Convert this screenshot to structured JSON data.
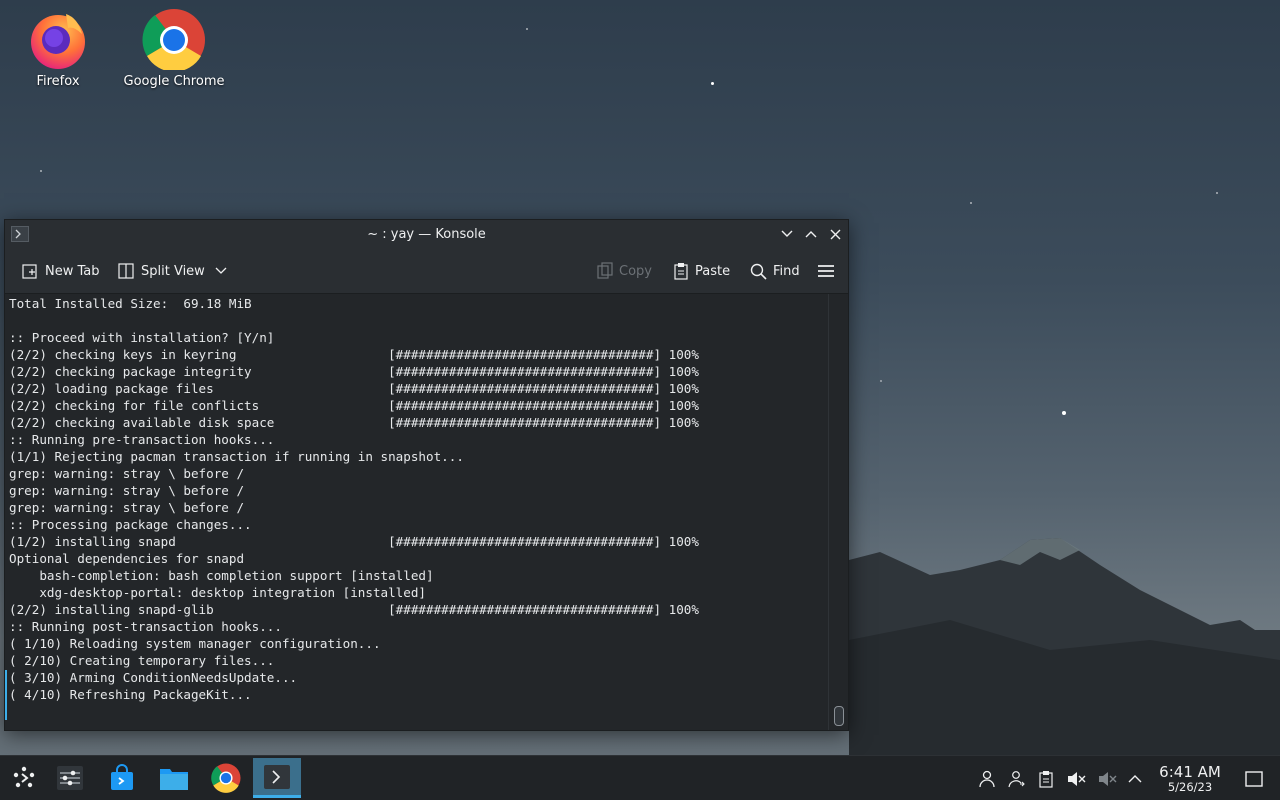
{
  "desktop": {
    "icons": [
      {
        "label": "Firefox"
      },
      {
        "label": "Google Chrome"
      }
    ]
  },
  "window": {
    "title": "~ : yay — Konsole",
    "toolbar": {
      "new_tab": "New Tab",
      "split_view": "Split View",
      "copy": "Copy",
      "paste": "Paste",
      "find": "Find"
    },
    "terminal_lines": [
      "Total Installed Size:  69.18 MiB",
      "",
      ":: Proceed with installation? [Y/n]",
      "(2/2) checking keys in keyring                    [##################################] 100%",
      "(2/2) checking package integrity                  [##################################] 100%",
      "(2/2) loading package files                       [##################################] 100%",
      "(2/2) checking for file conflicts                 [##################################] 100%",
      "(2/2) checking available disk space               [##################################] 100%",
      ":: Running pre-transaction hooks...",
      "(1/1) Rejecting pacman transaction if running in snapshot...",
      "grep: warning: stray \\ before /",
      "grep: warning: stray \\ before /",
      "grep: warning: stray \\ before /",
      ":: Processing package changes...",
      "(1/2) installing snapd                            [##################################] 100%",
      "Optional dependencies for snapd",
      "    bash-completion: bash completion support [installed]",
      "    xdg-desktop-portal: desktop integration [installed]",
      "(2/2) installing snapd-glib                       [##################################] 100%",
      ":: Running post-transaction hooks...",
      "( 1/10) Reloading system manager configuration...",
      "( 2/10) Creating temporary files...",
      "( 3/10) Arming ConditionNeedsUpdate...",
      "( 4/10) Refreshing PackageKit..."
    ]
  },
  "taskbar": {
    "apps": [
      "application-launcher-icon",
      "system-settings-icon",
      "discover-store-icon",
      "file-manager-icon",
      "google-chrome-icon",
      "konsole-icon"
    ],
    "clock": {
      "time": "6:41 AM",
      "date": "5/26/23"
    }
  },
  "colors": {
    "accent": "#3daee9",
    "window_bg": "#2a2e32",
    "terminal_bg": "#232629",
    "taskbar_bg": "#202326"
  }
}
